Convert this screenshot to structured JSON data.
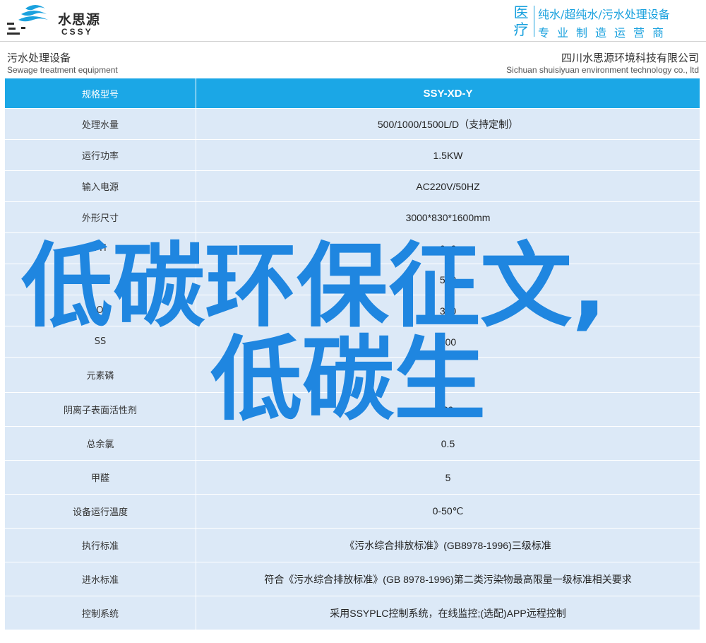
{
  "header": {
    "logo_cn": "水思源",
    "logo_en": "CSSY",
    "banner_big_1": "医",
    "banner_big_2": "疗",
    "banner_line1": "纯水/超纯水/污水处理设备",
    "banner_line2": "专业制造运营商"
  },
  "subheader": {
    "left_cn": "污水处理设备",
    "left_en": "Sewage treatment equipment",
    "right_cn": "四川水思源环境科技有限公司",
    "right_en": "Sichuan shuisiyuan environment technology co., ltd"
  },
  "table": {
    "header": {
      "label": "规格型号",
      "value": "SSY-XD-Y"
    },
    "rows": [
      {
        "label": "处理水量",
        "value": "500/1000/1500L/D（支持定制）"
      },
      {
        "label": "运行功率",
        "value": "1.5KW"
      },
      {
        "label": "输入电源",
        "value": "AC220V/50HZ"
      },
      {
        "label": "外形尺寸",
        "value": "3000*830*1600mm"
      },
      {
        "label": "PH",
        "value": "6~9"
      },
      {
        "label": "COD",
        "value": "500"
      },
      {
        "label": "BOD",
        "value": "300"
      },
      {
        "label": "SS",
        "value": "400"
      },
      {
        "label": "元素磷",
        "value": ""
      },
      {
        "label": "阴离子表面活性剂",
        "value": "20"
      },
      {
        "label": "总余氯",
        "value": "0.5"
      },
      {
        "label": "甲醛",
        "value": "5"
      },
      {
        "label": "设备运行温度",
        "value": "0-50℃"
      },
      {
        "label": "执行标准",
        "value": "《污水综合排放标准》(GB8978-1996)三级标准"
      },
      {
        "label": "进水标准",
        "value": "符合《污水综合排放标准》(GB 8978-1996)第二类污染物最高限量一级标准相关要求"
      },
      {
        "label": "控制系统",
        "value": "采用SSYPLC控制系统，在线监控;(选配)APP远程控制"
      }
    ]
  },
  "overlay": {
    "line1": "低碳环保征文,",
    "line2": "低碳生"
  },
  "colors": {
    "header_row": "#1ba7e6",
    "row_bg": "#dce9f7",
    "banner": "#1aa1de",
    "overlay_text": "#1f86e0"
  },
  "icons": {
    "logo": "water-waves-logo-icon"
  }
}
